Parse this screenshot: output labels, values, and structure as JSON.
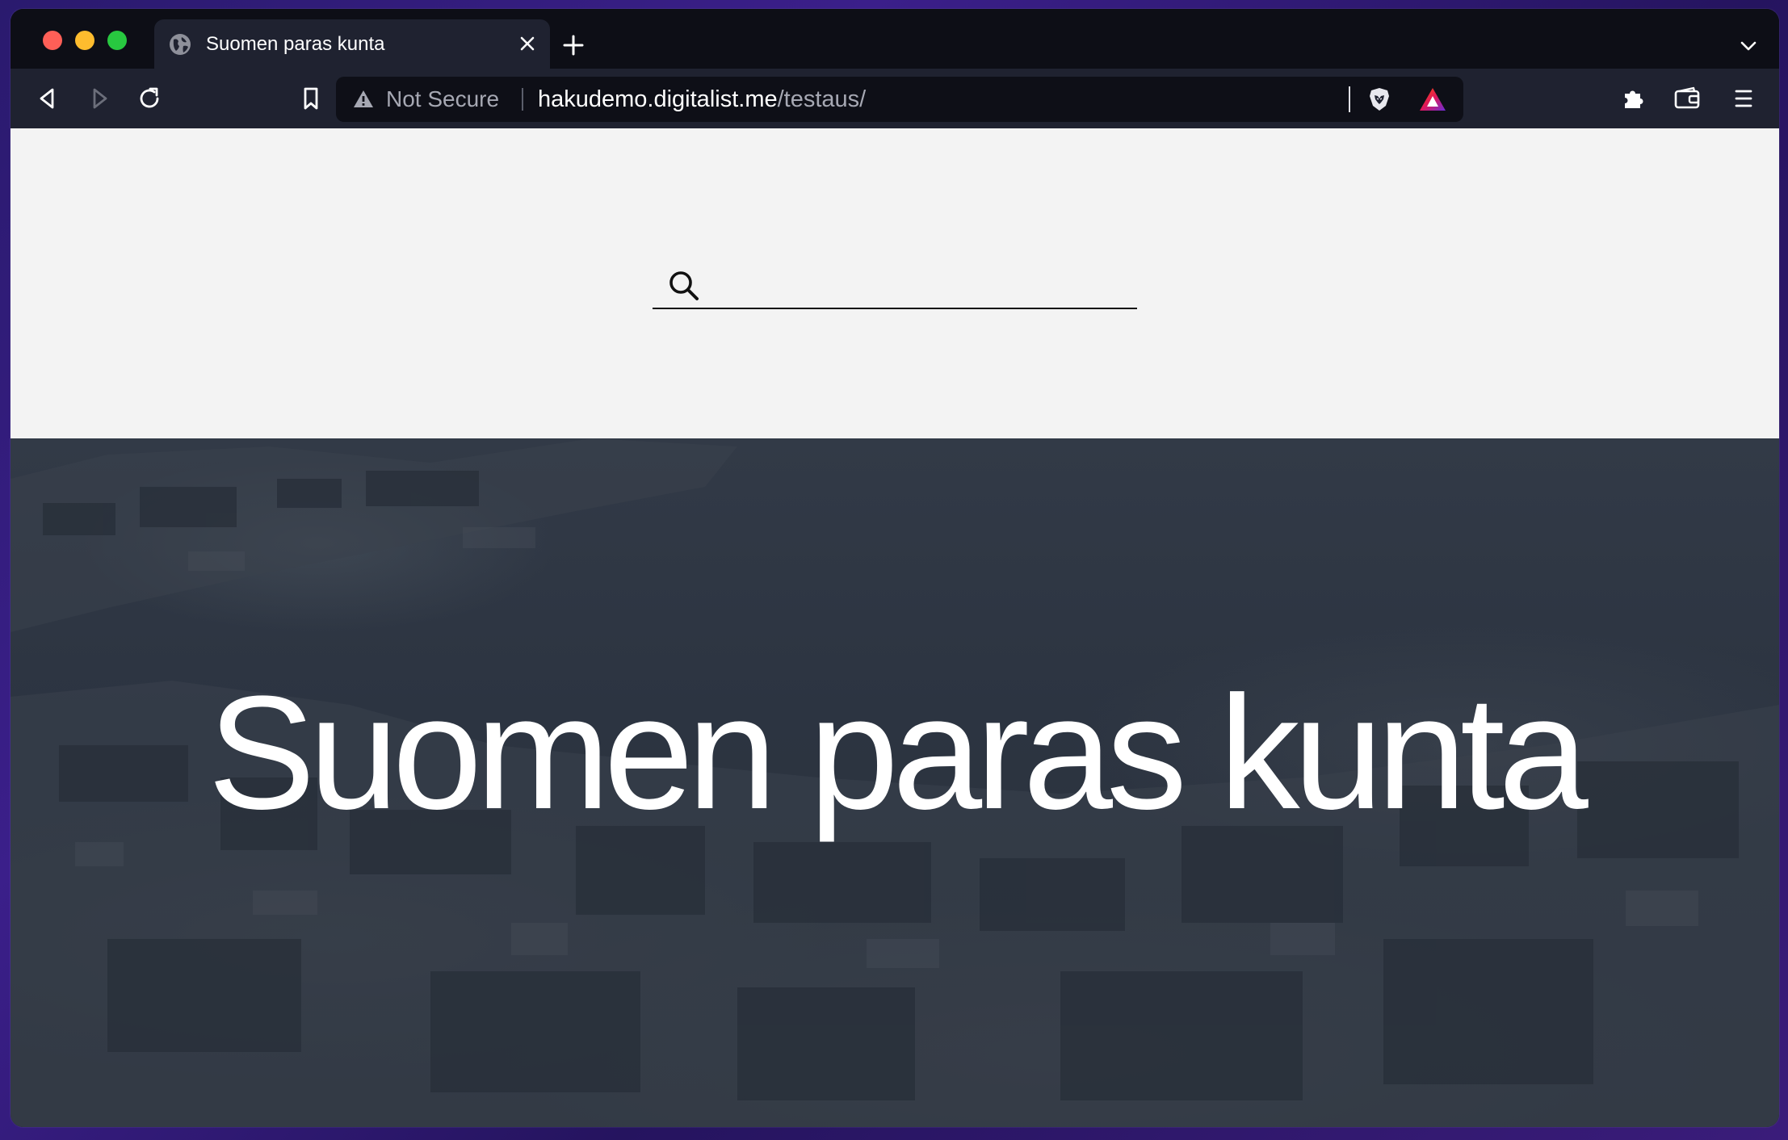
{
  "browser": {
    "tab": {
      "title": "Suomen paras kunta",
      "favicon": "globe-icon"
    },
    "address_bar": {
      "security_label": "Not Secure",
      "url_host": "hakudemo.digitalist.me",
      "url_path": "/testaus/"
    },
    "icons": [
      "back-arrow-icon",
      "forward-arrow-icon",
      "reload-icon",
      "bookmark-icon",
      "warning-triangle-icon",
      "brave-shield-icon",
      "brave-rewards-icon",
      "extensions-puzzle-icon",
      "wallet-icon",
      "hamburger-menu-icon",
      "new-tab-plus-icon",
      "tab-close-icon",
      "tab-list-chevron-icon"
    ]
  },
  "page": {
    "search": {
      "placeholder": "",
      "value": ""
    },
    "hero": {
      "title": "Suomen paras kunta"
    }
  },
  "colors": {
    "desktop_bg": "#2a1a6e",
    "chrome_dark": "#0d0e16",
    "toolbar": "#1f2230",
    "search_panel_bg": "#f3f3f3",
    "hero_overlay": "#2a3240",
    "hero_text": "#ffffff"
  }
}
